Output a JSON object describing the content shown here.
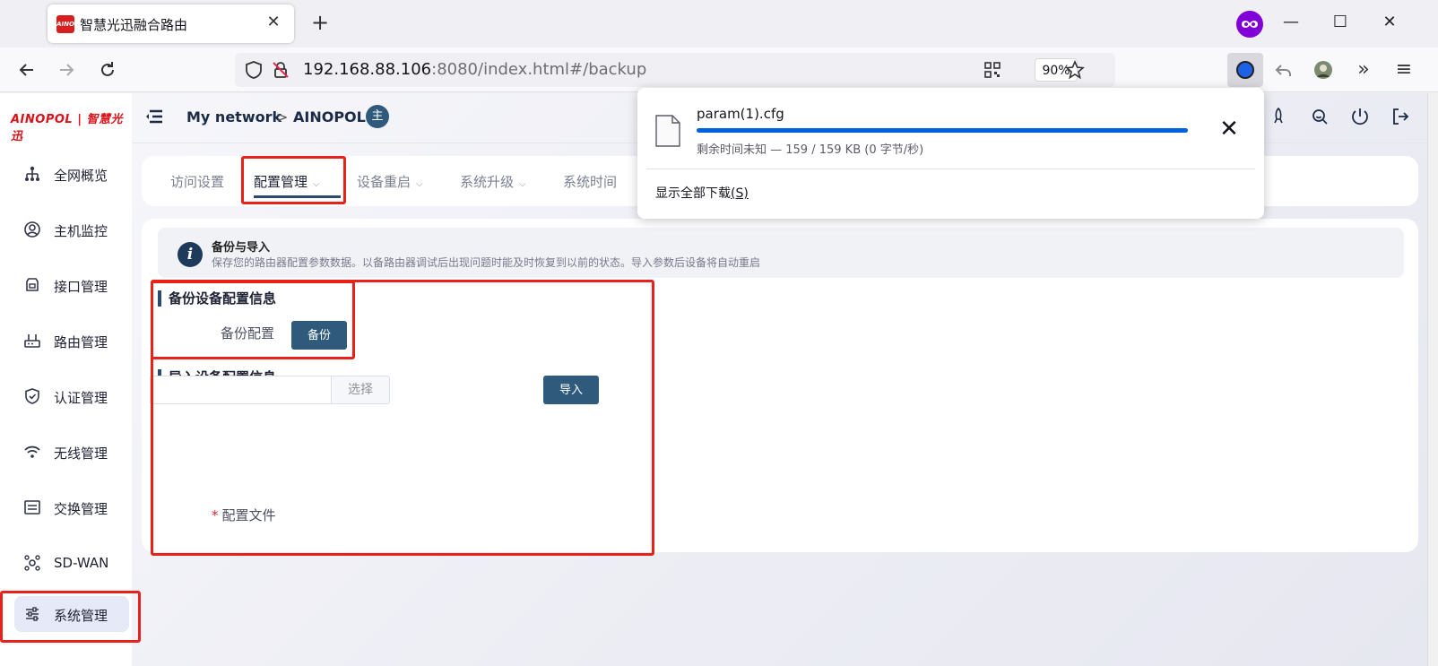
{
  "browser": {
    "tab_title": "智慧光迅融合路由",
    "favicon_text": "AINO",
    "tab_close": "✕",
    "new_tab": "+",
    "url_host": "192.168.88.106",
    "url_rest": ":8080/index.html#/backup",
    "zoom": "90%",
    "icons": [
      "back-arrow-icon",
      "forward-arrow-icon",
      "reload-icon",
      "shield-icon",
      "insecure-lock-icon",
      "qr-code-icon",
      "bookmark-star-icon",
      "extension-icon",
      "undo-icon",
      "profile-avatar-icon",
      "overflow-chevrons-icon",
      "hamburger-menu-icon"
    ]
  },
  "app": {
    "logo_text": "AINOPOL | 智慧光迅",
    "breadcrumb": {
      "first": "My network",
      "separator": ">",
      "second": "AINOPOL",
      "role_badge": "主"
    },
    "sidebar": {
      "items": [
        {
          "label": "全网概览",
          "icon": "topology-icon"
        },
        {
          "label": "主机监控",
          "icon": "user-circle-icon"
        },
        {
          "label": "接口管理",
          "icon": "interface-icon"
        },
        {
          "label": "路由管理",
          "icon": "router-icon"
        },
        {
          "label": "认证管理",
          "icon": "shield-check-icon"
        },
        {
          "label": "无线管理",
          "icon": "wifi-icon"
        },
        {
          "label": "交换管理",
          "icon": "switch-icon"
        },
        {
          "label": "SD-WAN",
          "icon": "sdwan-icon"
        },
        {
          "label": "系统管理",
          "icon": "sliders-icon",
          "active": true
        }
      ]
    },
    "tabs": [
      {
        "label": "访问设置",
        "dropdown": false
      },
      {
        "label": "配置管理",
        "dropdown": true,
        "active": true
      },
      {
        "label": "设备重启",
        "dropdown": true
      },
      {
        "label": "系统升级",
        "dropdown": true
      },
      {
        "label": "系统时间",
        "dropdown": false
      }
    ],
    "info": {
      "title": "备份与导入",
      "description": "保存您的路由器配置参数数据。以备路由器调试后出现问题时能及时恢复到以前的状态。导入参数后设备将自动重启"
    },
    "backup_section": {
      "title": "备份设备配置信息",
      "label": "备份配置",
      "button": "备份"
    },
    "import_section": {
      "title": "导入设备配置信息",
      "required_mark": "*",
      "label": "配置文件",
      "file_value": "",
      "pick_button": "选择",
      "import_button": "导入"
    }
  },
  "download_panel": {
    "filename": "param(1).cfg",
    "status": "剩余时间未知 — 159 / 159 KB (0 字节/秒)",
    "progress": 1.0,
    "show_all": "显示全部下载",
    "show_all_accesskey": "(S)",
    "close": "✕"
  },
  "colors": {
    "accent": "#2f5a7c",
    "annotation": "#e8221b",
    "download_progress": "#0061e0",
    "private_badge": "#8000d7"
  }
}
